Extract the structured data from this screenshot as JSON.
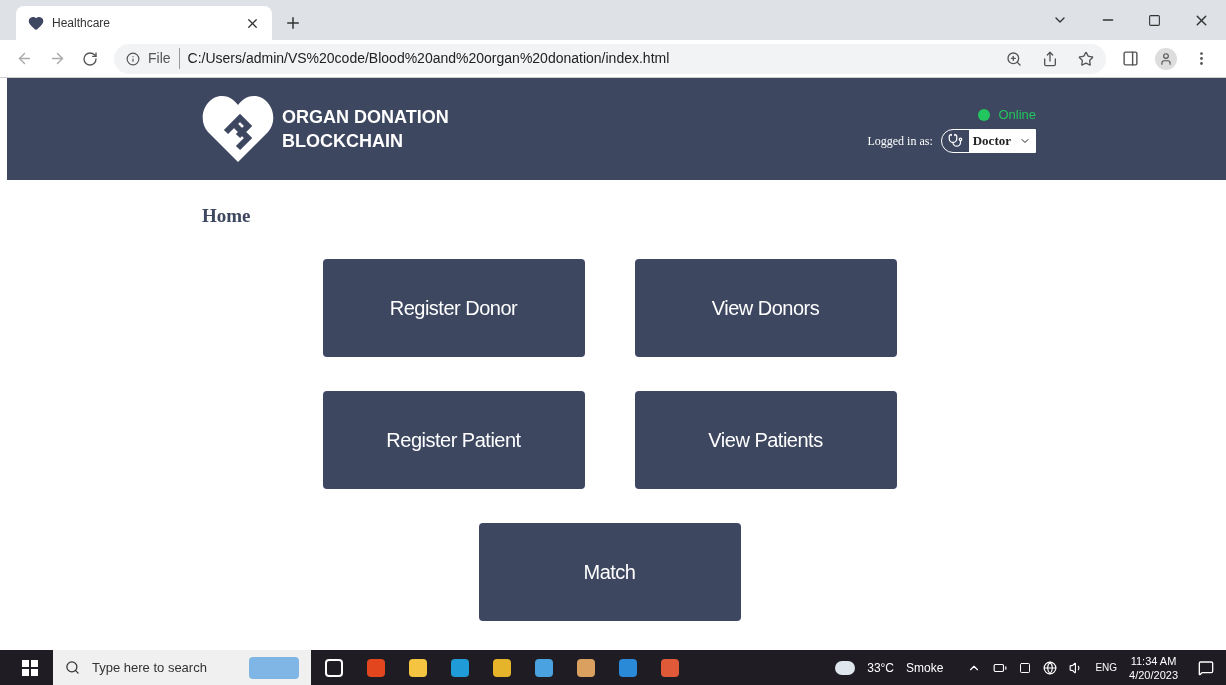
{
  "browser": {
    "tab_title": "Healthcare",
    "scheme_label": "File",
    "url": "C:/Users/admin/VS%20code/Blood%20and%20organ%20donation/index.html"
  },
  "header": {
    "brand": [
      "ORGAN DONATION",
      "BLOCKCHAIN"
    ],
    "status": "Online",
    "logged_in_label": "Logged in as:",
    "role": "Doctor"
  },
  "breadcrumb": "Home",
  "actions": [
    {
      "label": "Register Donor"
    },
    {
      "label": "View Donors"
    },
    {
      "label": "Register Patient"
    },
    {
      "label": "View Patients"
    },
    {
      "label": "Match"
    }
  ],
  "taskbar": {
    "search_placeholder": "Type here to search",
    "temperature": "33°C",
    "weather": "Smoke",
    "language": "ENG",
    "time": "11:34 AM",
    "date": "4/20/2023"
  }
}
